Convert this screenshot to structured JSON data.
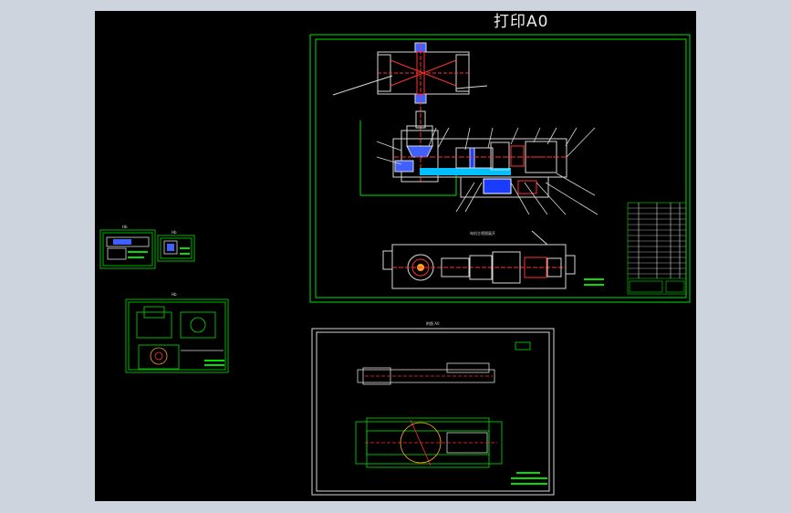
{
  "title": "打印A0",
  "sheets": {
    "sub1_label": "Hb",
    "sub2_label": "Hb",
    "sub3_label": "Hb",
    "bottom_label": "附图 A0",
    "top_plan_label": "电机主视图展开"
  },
  "colors": {
    "background": "#000000",
    "border": "#00ff00",
    "accent_red": "#ff2020",
    "accent_cyan": "#00e5ff",
    "accent_blue": "#2040ff",
    "surround": "#ced4de"
  }
}
